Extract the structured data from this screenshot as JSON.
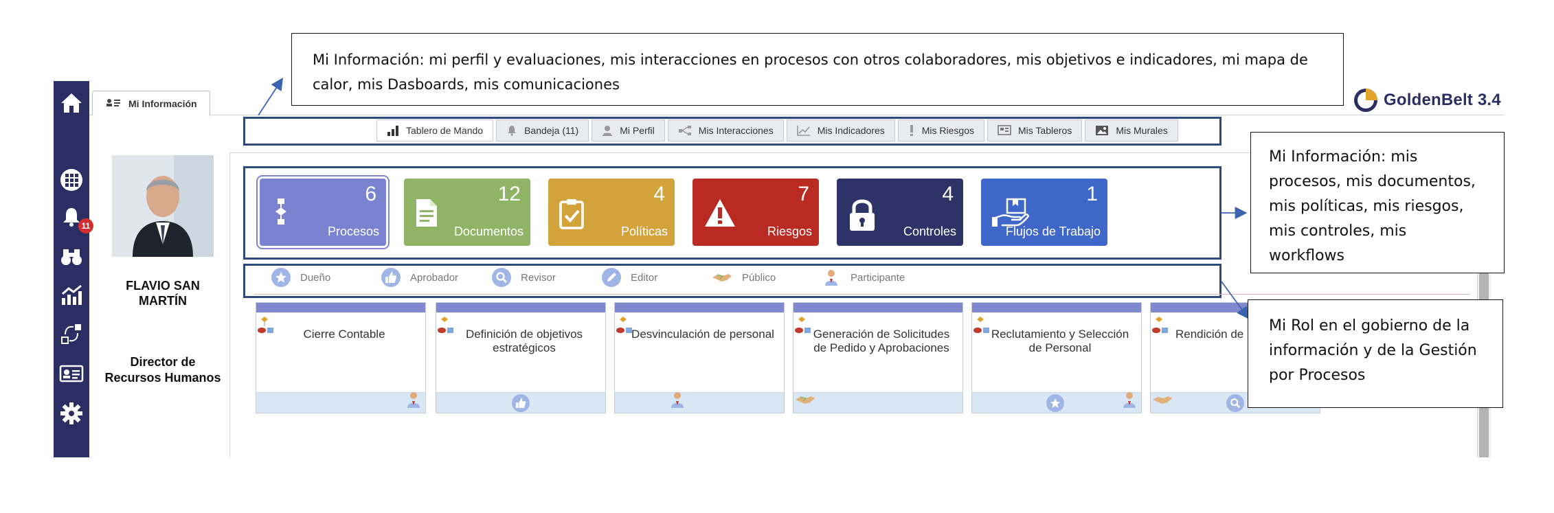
{
  "app": {
    "logo_text": "GoldenBelt 3.4",
    "brand_color": "#2b2e63"
  },
  "tab": {
    "label": "Mi Información",
    "icon": "id-card-icon"
  },
  "sidebar": {
    "items": [
      {
        "icon": "home-icon"
      },
      {
        "icon": "grid-icon"
      },
      {
        "icon": "bell-icon",
        "badge": "11"
      },
      {
        "icon": "binoculars-icon"
      },
      {
        "icon": "chart-icon"
      },
      {
        "icon": "workflow-icon"
      },
      {
        "icon": "id-card-icon"
      },
      {
        "icon": "gear-icon"
      }
    ]
  },
  "toolbar": {
    "buttons": [
      {
        "label": "Tablero de Mando",
        "icon": "bar-chart-icon"
      },
      {
        "label": "Bandeja (11)",
        "icon": "bell-icon"
      },
      {
        "label": "Mi Perfil",
        "icon": "user-icon"
      },
      {
        "label": "Mis Interacciones",
        "icon": "network-icon"
      },
      {
        "label": "Mis Indicadores",
        "icon": "trend-icon"
      },
      {
        "label": "Mis Riesgos",
        "icon": "exclamation-icon"
      },
      {
        "label": "Mis Tableros",
        "icon": "dashboard-icon"
      },
      {
        "label": "Mis Murales",
        "icon": "image-icon"
      }
    ]
  },
  "profile": {
    "name": "FLAVIO SAN MARTÍN",
    "role": "Director de Recursos Humanos"
  },
  "tiles": [
    {
      "count": "6",
      "label": "Procesos",
      "color": "#7a83cf",
      "icon": "process-icon"
    },
    {
      "count": "12",
      "label": "Documentos",
      "color": "#8fb466",
      "icon": "document-icon"
    },
    {
      "count": "4",
      "label": "Políticas",
      "color": "#d3a33b",
      "icon": "clipboard-icon"
    },
    {
      "count": "7",
      "label": "Riesgos",
      "color": "#b92a22",
      "icon": "warning-icon"
    },
    {
      "count": "4",
      "label": "Controles",
      "color": "#2d3366",
      "icon": "lock-icon"
    },
    {
      "count": "1",
      "label": "Flujos de Trabajo",
      "color": "#3f67c9",
      "icon": "workflow-hand-icon"
    }
  ],
  "roles": [
    {
      "label": "Dueño",
      "icon": "star-icon"
    },
    {
      "label": "Aprobador",
      "icon": "thumbs-up-icon"
    },
    {
      "label": "Revisor",
      "icon": "magnifier-icon"
    },
    {
      "label": "Editor",
      "icon": "pencil-icon"
    },
    {
      "label": "Público",
      "icon": "handshake-icon"
    },
    {
      "label": "Participante",
      "icon": "person-icon"
    }
  ],
  "cards": [
    {
      "title": "Cierre Contable"
    },
    {
      "title": "Definición de objetivos estratégicos"
    },
    {
      "title": "Desvinculación de personal"
    },
    {
      "title": "Generación de Solicitudes de Pedido y Aprobaciones"
    },
    {
      "title": "Reclutamiento y Selección de Personal"
    },
    {
      "title": "Rendición de"
    }
  ],
  "callouts": {
    "top": "Mi Información: mi perfil y evaluaciones, mis interacciones en procesos con otros colaboradores, mis objetivos e  indicadores, mi mapa de calor, mis Dasboards, mis comunicaciones",
    "right": "Mi Información: mis procesos, mis documentos, mis políticas, mis riesgos, mis controles, mis workflows",
    "bottom": "Mi Rol en el gobierno de la información y de la Gestión por Procesos"
  }
}
